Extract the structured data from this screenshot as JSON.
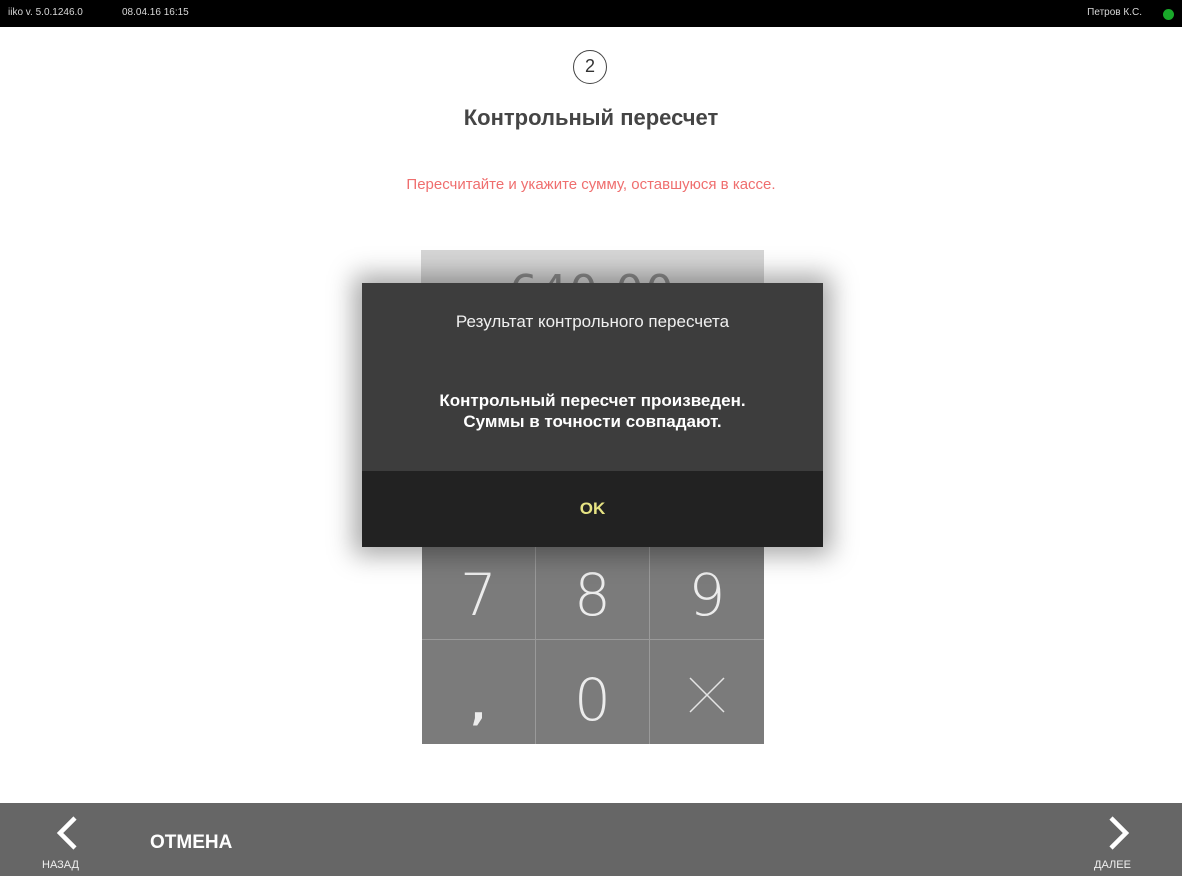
{
  "topbar": {
    "version": "iiko v. 5.0.1246.0",
    "datetime": "08.04.16  16:15",
    "user": "Петров К.С.",
    "status_color": "#19a82a"
  },
  "step": {
    "number": "2"
  },
  "page": {
    "title": "Контрольный пересчет",
    "instruction": "Пересчитайте и укажите сумму, оставшуюся в кассе."
  },
  "amount": {
    "value": "640,00"
  },
  "keypad": {
    "keys": [
      "7",
      "8",
      "9",
      ",",
      "0"
    ],
    "clear_icon": "close-icon"
  },
  "dialog": {
    "title": "Результат контрольного пересчета",
    "message_line1": "Контрольный пересчет произведен.",
    "message_line2": "Суммы в точности совпадают.",
    "ok_label": "OK",
    "ok_color": "#e6e383"
  },
  "bottom": {
    "back_label": "НАЗАД",
    "cancel_label": "ОТМЕНА",
    "next_label": "ДАЛЕЕ"
  }
}
